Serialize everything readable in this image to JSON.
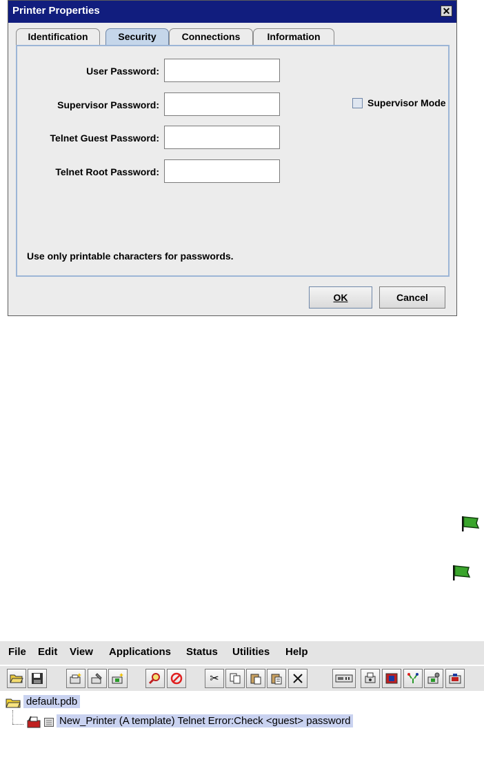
{
  "dialog": {
    "title": "Printer Properties",
    "close_label": "✕",
    "tabs": [
      {
        "label": "Identification",
        "active": false
      },
      {
        "label": "Security",
        "active": true
      },
      {
        "label": "Connections",
        "active": false
      },
      {
        "label": "Information",
        "active": false
      }
    ],
    "fields": [
      {
        "label": "User Password:",
        "value": ""
      },
      {
        "label": "Supervisor Password:",
        "value": ""
      },
      {
        "label": "Telnet Guest Password:",
        "value": ""
      },
      {
        "label": "Telnet Root Password:",
        "value": ""
      }
    ],
    "supervisor_mode": {
      "label": "Supervisor Mode",
      "checked": false
    },
    "hint": "Use only printable characters for passwords.",
    "ok_label": "OK",
    "cancel_label": "Cancel"
  },
  "app": {
    "menu": [
      {
        "label": "File"
      },
      {
        "label": "Edit"
      },
      {
        "label": "View"
      },
      {
        "label": "Applications"
      },
      {
        "label": "Status"
      },
      {
        "label": "Utilities"
      },
      {
        "label": "Help"
      }
    ],
    "tree": {
      "root_label": "default.pdb",
      "child_label": "New_Printer (A template) Telnet Error:Check <guest> password"
    }
  },
  "colors": {
    "title_bar": "#111d7e",
    "active_tab": "#c5d6ea",
    "panel_border": "#9cb5d6",
    "tree_highlight": "#c9d2f0",
    "flag_green": "#3aa52c"
  }
}
